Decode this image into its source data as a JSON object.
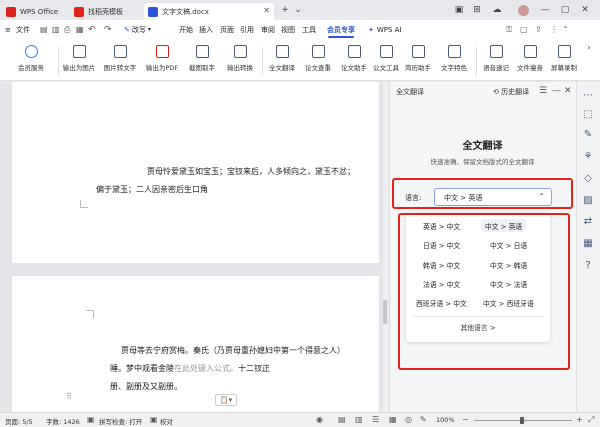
{
  "titlebar": {
    "tabs": [
      {
        "label": "WPS Office",
        "color": "#d9251c"
      },
      {
        "label": "找稻壳模板",
        "color": "#e0241b"
      },
      {
        "label": "文字文稿.docx",
        "color": "#2b55d6"
      }
    ],
    "new_tab": "+",
    "tab_menu": "⌄"
  },
  "menubar": {
    "file": "文件",
    "undo_redo": [
      "↶",
      "↷"
    ],
    "rewrite": "改写",
    "items": [
      "开始",
      "插入",
      "页面",
      "引用",
      "审阅",
      "视图",
      "工具",
      "会员专享"
    ],
    "wps_ai": "WPS AI"
  },
  "ribbon": {
    "items": [
      "会员服务",
      "输出为图片",
      "图片转文字",
      "输出为PDF",
      "截图取字",
      "输出转换",
      "全文翻译",
      "论文查重",
      "论文助手",
      "公文工具",
      "简历助手",
      "文字特色",
      "语音速记",
      "文件瘦身",
      "屏幕录制"
    ]
  },
  "document": {
    "page1": {
      "line1": "贾母怜爱黛玉如宝玉；宝钗来后，人多倾向之，黛玉不忿；",
      "line2": "偏于黛玉；二人因亲密后生口角"
    },
    "page2": {
      "line1": "贾母等去宁府赏梅。秦氏（乃贾母重孙媳妇中第一个得意之人）",
      "line2_a": "睡。梦中观看金陵",
      "line2_placeholder": "在此处键入公式。",
      "line2_b": "十二钗正",
      "line3": "册、副册及又副册。"
    }
  },
  "panel": {
    "header": "全文翻译",
    "history": "历史翻译",
    "title": "全文翻译",
    "subtitle": "快速准确、保留文档版式的全文翻译",
    "language_label": "语言:",
    "language_value": "中文 > 英语",
    "options": [
      {
        "left": "英语 > 中文",
        "right": "中文 > 英语"
      },
      {
        "left": "日语 > 中文",
        "right": "中文 > 日语"
      },
      {
        "left": "韩语 > 中文",
        "right": "中文 > 韩语"
      },
      {
        "left": "法语 > 中文",
        "right": "中文 > 法语"
      },
      {
        "left": "西班牙语 > 中文",
        "right": "中文 > 西班牙语"
      }
    ],
    "more": "其他语言 >"
  },
  "statusbar": {
    "page": "页面: 5/5",
    "words": "字数: 1426",
    "spell": "拼写检查: 打开",
    "proof": "校对",
    "zoom": "100%"
  },
  "colors": {
    "accent": "#2b55d6",
    "highlight": "#e0241b"
  }
}
